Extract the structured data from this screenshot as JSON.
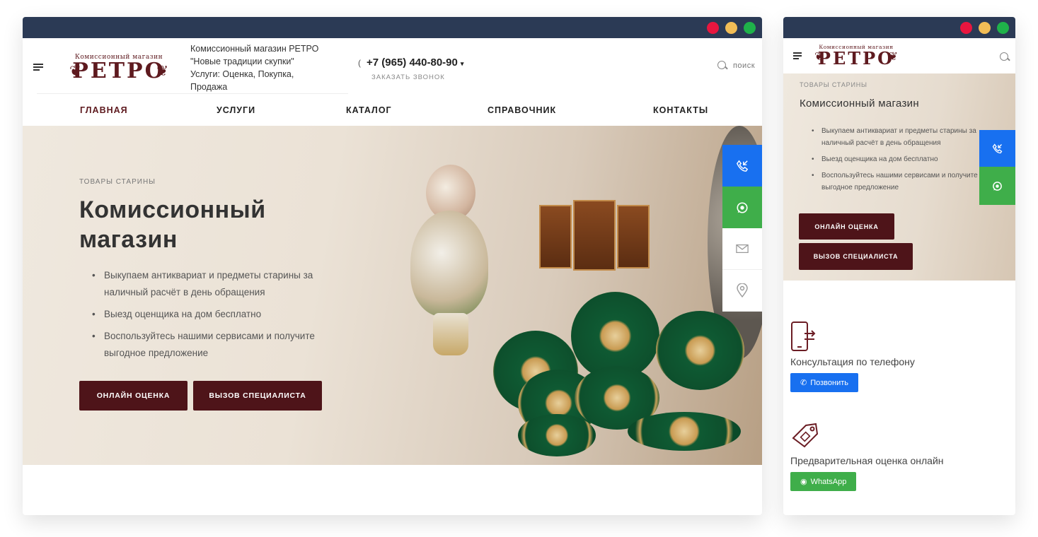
{
  "desktop": {
    "logo": {
      "top_text": "Комиссионный магазин",
      "main_text": "РЕТРО"
    },
    "shop_info": {
      "line1": "Комиссионный магазин РЕТРО",
      "line2": "\"Новые традиции скупки\"",
      "line3": "Услуги: Оценка, Покупка,",
      "line4": "Продажа"
    },
    "phone": "+7 (965) 440-80-90",
    "callback_label": "ЗАКАЗАТЬ ЗВОНОК",
    "search_label": "ПОИСК",
    "nav": [
      {
        "label": "ГЛАВНАЯ"
      },
      {
        "label": "УСЛУГИ"
      },
      {
        "label": "КАТАЛОГ"
      },
      {
        "label": "СПРАВОЧНИК"
      },
      {
        "label": "КОНТАКТЫ"
      }
    ],
    "hero": {
      "kicker": "ТОВАРЫ СТАРИНЫ",
      "title": "Комиссионный магазин",
      "bullets": [
        "Выкупаем антиквариат и предметы старины за наличный расчёт в день обращения",
        "Выезд оценщика на дом бесплатно",
        "Воспользуйтесь нашими сервисами и получите выгодное предложение"
      ],
      "btn_online": "ОНЛАЙН ОЦЕНКА",
      "btn_specialist": "ВЫЗОВ СПЕЦИАЛИСТА"
    }
  },
  "mobile": {
    "logo": {
      "top_text": "Комиссионный магазин",
      "main_text": "РЕТРО"
    },
    "hero": {
      "kicker": "ТОВАРЫ СТАРИНЫ",
      "title": "Комиссионный магазин",
      "bullets": [
        "Выкупаем антиквариат и предметы старины за наличный расчёт в день обращения",
        "Выезд оценщика на дом бесплатно",
        "Воспользуйтесь нашими сервисами и получите выгодное предложение"
      ],
      "btn_online": "ОНЛАЙН ОЦЕНКА",
      "btn_specialist": "ВЫЗОВ СПЕЦИАЛИСТА"
    },
    "features": [
      {
        "icon": "phone-consult-icon",
        "text": "Консультация по телефону",
        "button": "Позвонить"
      },
      {
        "icon": "price-tag-icon",
        "text": "Предварительная оценка онлайн",
        "button": "WhatsApp"
      }
    ]
  },
  "side_widget": [
    "callback-icon",
    "whatsapp-icon",
    "mail-icon",
    "location-icon"
  ],
  "colors": {
    "titlebar": "#2b3a55",
    "brand": "#5e1a1f",
    "button_dark": "#4e1419",
    "widget_blue": "#1870f0",
    "widget_green": "#3fae4a"
  }
}
